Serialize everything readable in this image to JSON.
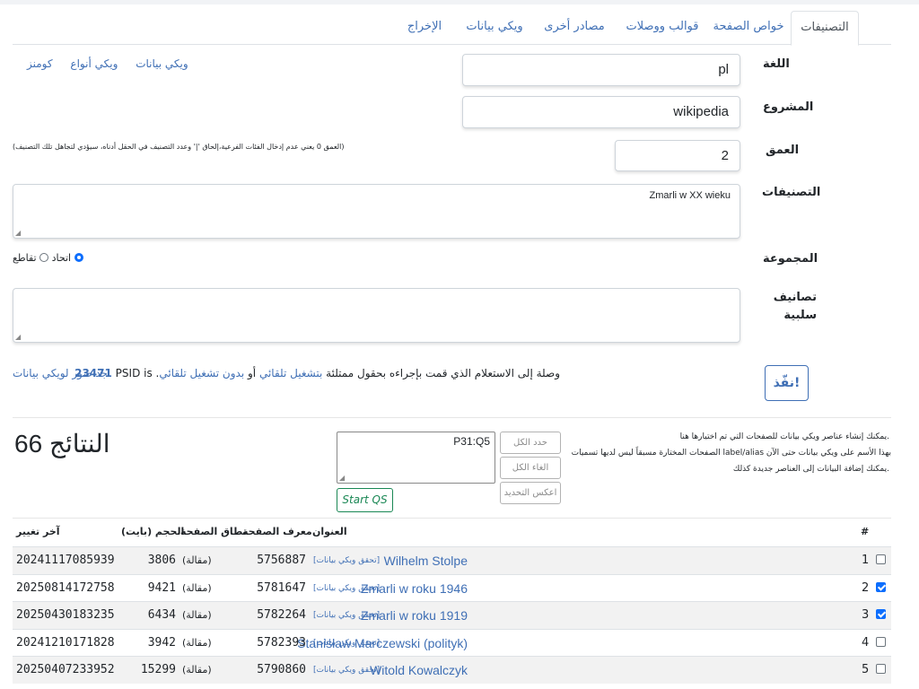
{
  "tabs": [
    "التصنيفات",
    "خواص الصفحة",
    "قوالب ووصلات",
    "مصادر أخرى",
    "ويكي بيانات",
    "الإخراج"
  ],
  "form": {
    "language_label": "اللغة",
    "language_value": "pl",
    "project_label": "المشروع",
    "project_value": "wikipedia",
    "depth_label": "العمق",
    "depth_value": "2",
    "depth_note": "(العمق 0 يعني عدم إدخال الفئات الفرعية،إلحاق '|' وعدد التصنيف في الحقل أدناه، سيؤدي لتجاهل تلك التصنيف)",
    "categories_label": "التصنيفات",
    "categories_value": "Zmarli w XX wieku",
    "combination_label": "المجموعة",
    "radio_intersection": "تقاطع",
    "radio_union": "اتحاد",
    "negative_label": "تصانيف سلبية",
    "wiki_links": [
      "كومنز",
      "ويكي أنواع",
      "ويكي بيانات"
    ]
  },
  "run": {
    "doit_label": "نفّذ!",
    "text_prefix": "وصلة إلى الاستعلام الذي قمت بإجراءه بحقول ممتلئة",
    "link_autorun": "بتشغيل تلقائي",
    "text_or": "أو",
    "link_no_autorun": "بدون تشغيل تلقائي",
    "psid_label": "PSID is",
    "psid_value": "23471",
    "link_images": "جد صور لويكي بيانات."
  },
  "results": {
    "count_text": "66 النتائج",
    "qs_value": "P31:Q5",
    "select_all": "حدد الكل",
    "deselect_all": "الغاء الكل",
    "invert": "اعكس التحديد",
    "start_qs": "Start QS",
    "note_line1": "يمكنك إنشاء عناصر ويكي بيانات للصفحات التي تم اختيارها هنا.",
    "note_line2": "الصفحات المختارة مسبقاً ليس لديها تسميات label/alias بهذا الأسم على ويكي بيانات حتى الآن",
    "note_line3": "يمكنك إضافة البيانات إلى العناصر جديدة كذلك."
  },
  "table": {
    "headers": {
      "num": "#",
      "title": "العنوان",
      "page_id": "معرف الصفحة",
      "namespace": "نطاق الصفحة",
      "size": "الحجم (بايت)",
      "last_change": "آخر تغيير"
    },
    "check_wd_label": "[تحقق ويكي بيانات]",
    "rows": [
      {
        "num": "1",
        "checked": false,
        "title": "Wilhelm Stolpe",
        "page_id": "5756887",
        "namespace": "(مقالة)",
        "size": "3806",
        "last_change": "20241117085939"
      },
      {
        "num": "2",
        "checked": true,
        "title": "Zmarli w roku 1946",
        "page_id": "5781647",
        "namespace": "(مقالة)",
        "size": "9421",
        "last_change": "20250814172758"
      },
      {
        "num": "3",
        "checked": true,
        "title": "Zmarli w roku 1919",
        "page_id": "5782264",
        "namespace": "(مقالة)",
        "size": "6434",
        "last_change": "20250430183235"
      },
      {
        "num": "4",
        "checked": false,
        "title": "Stanisław Marczewski (polityk)",
        "page_id": "5782393",
        "namespace": "(مقالة)",
        "size": "3942",
        "last_change": "20241210171828"
      },
      {
        "num": "5",
        "checked": false,
        "title": "Witold Kowalczyk",
        "page_id": "5790860",
        "namespace": "(مقالة)",
        "size": "15299",
        "last_change": "20250407233952"
      }
    ]
  },
  "colors": {
    "link": "#3f6fb5",
    "primary": "#0d6efd",
    "success": "#198754"
  }
}
